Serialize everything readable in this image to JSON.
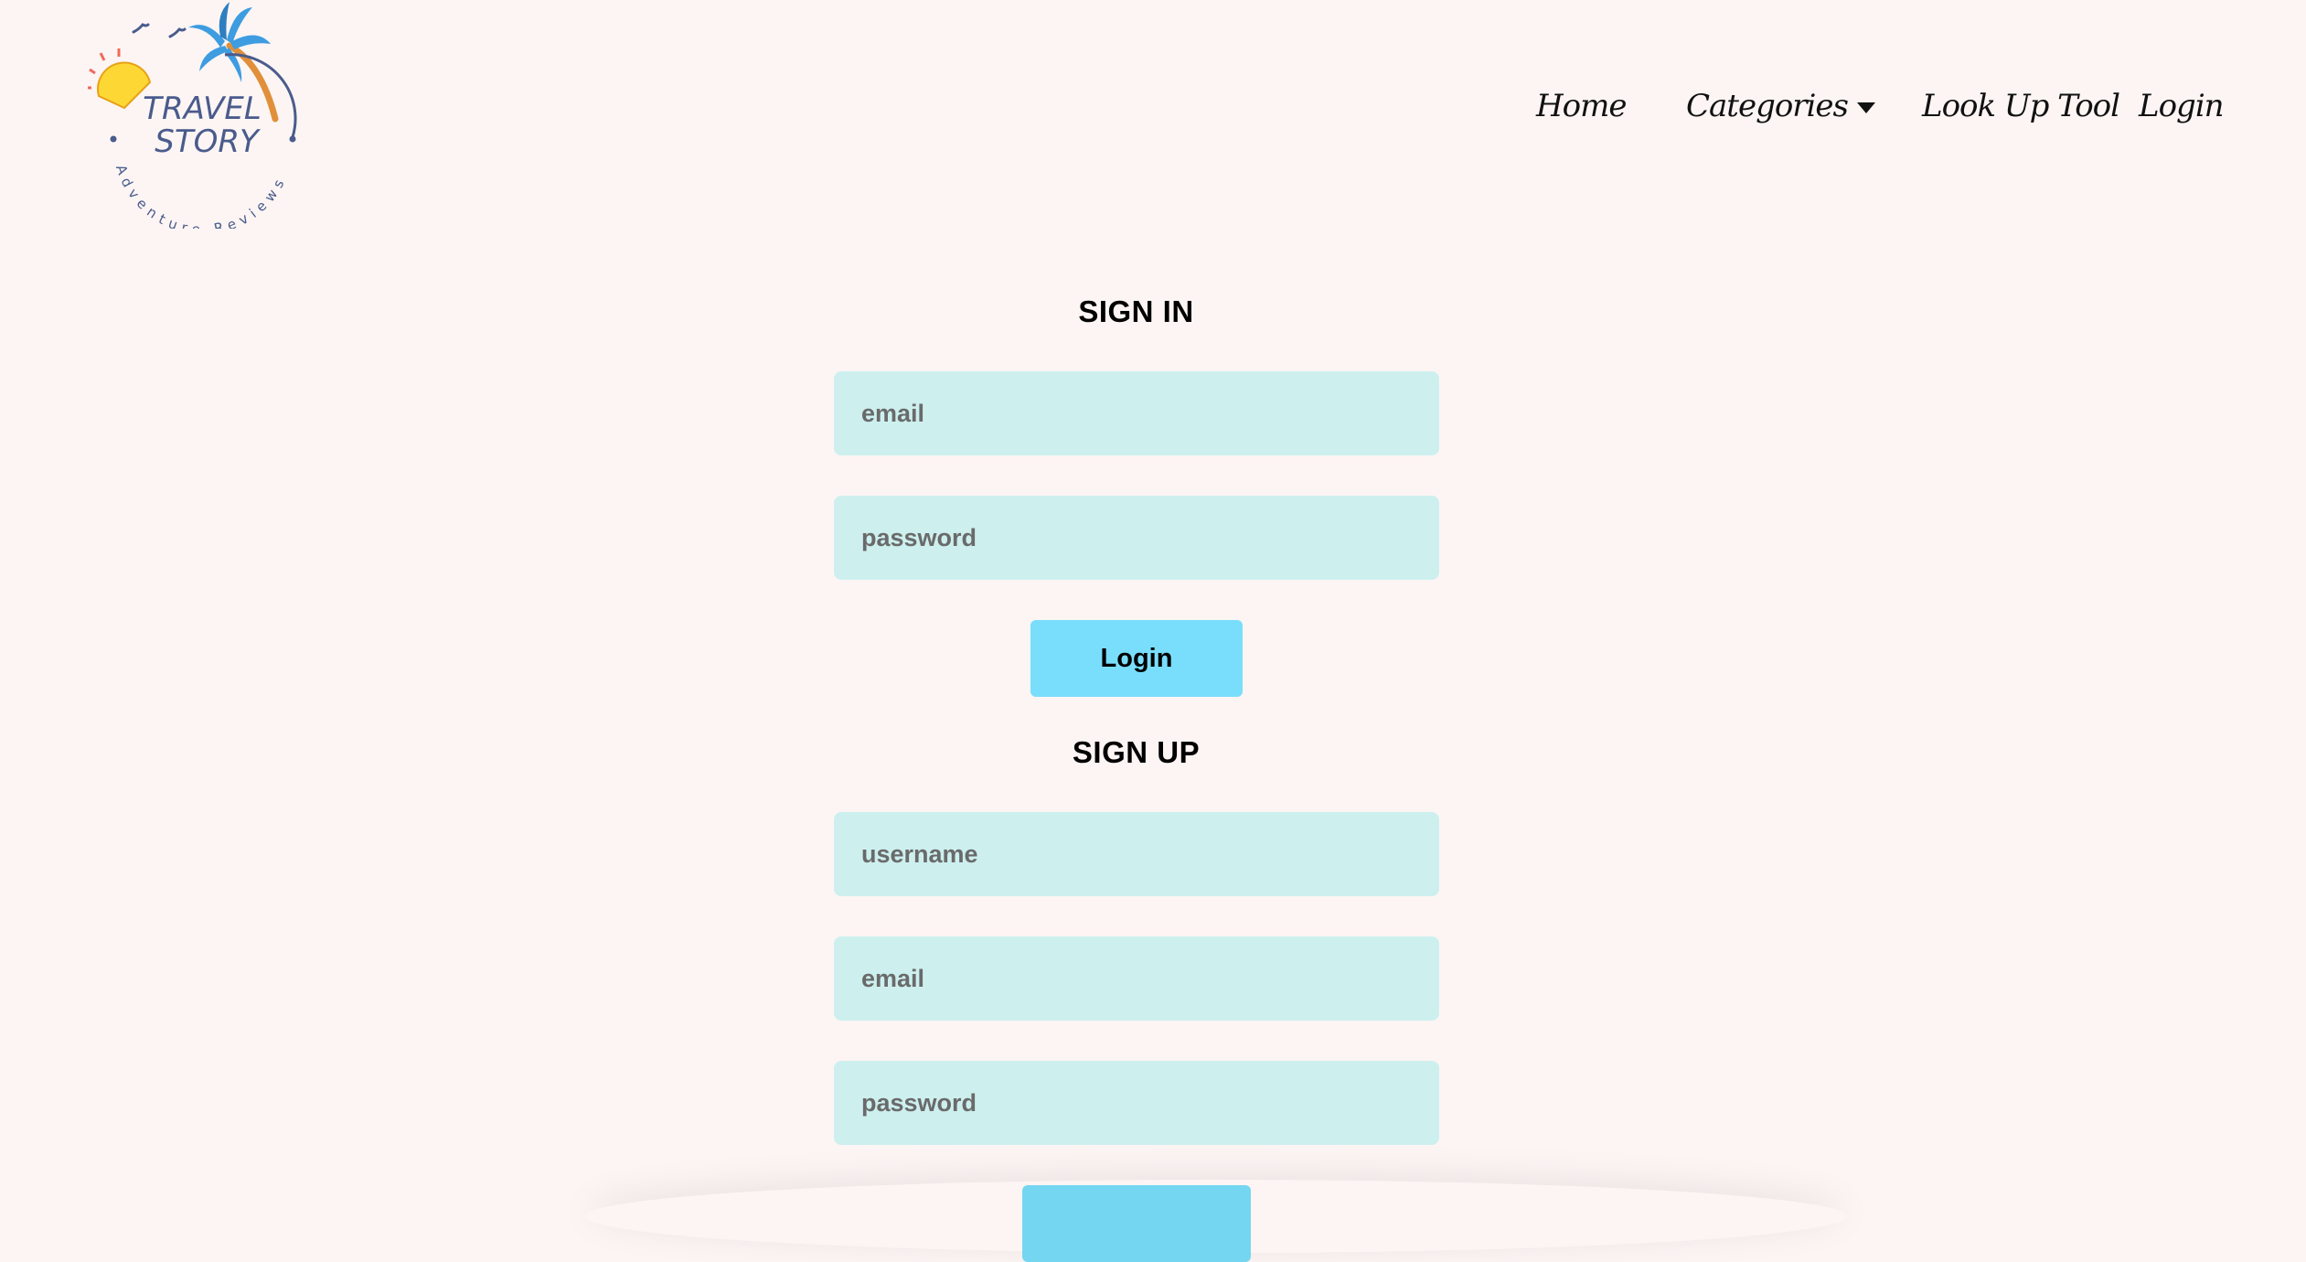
{
  "logo": {
    "line1": "TRAVEL",
    "line2": "STORY",
    "tagline": "Adventure Reviews"
  },
  "nav": {
    "home": "Home",
    "categories": "Categories",
    "lookup": "Look Up Tool",
    "login": "Login"
  },
  "signin": {
    "title": "SIGN IN",
    "email_placeholder": "email",
    "password_placeholder": "password",
    "button": "Login"
  },
  "signup": {
    "title": "SIGN UP",
    "username_placeholder": "username",
    "email_placeholder": "email",
    "password_placeholder": "password"
  },
  "colors": {
    "background": "#fcf5f4",
    "input_bg": "#cdf0ef",
    "button_bg": "#79defb",
    "logo_text": "#4a5b8c"
  }
}
